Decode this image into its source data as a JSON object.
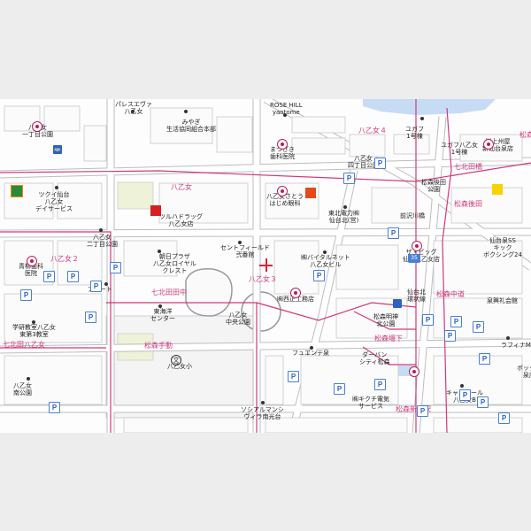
{
  "colors": {
    "road": "#ffffff",
    "road_edge": "#bdbdbd",
    "block": "#f3f3f3",
    "boundary": "#d0397c",
    "water": "#c6dcf4",
    "park": "#dfe9c9",
    "outside": "#ededed",
    "marker": "#e0203a"
  },
  "marker": {
    "icon": "crosshair-marker-icon"
  },
  "areas": [
    {
      "name": "八乙女"
    },
    {
      "name": "八乙女４"
    },
    {
      "name": "八乙女２"
    },
    {
      "name": "八乙女３"
    },
    {
      "name": "七北田田中"
    },
    {
      "name": "松森手動"
    },
    {
      "name": "七北田八乙女"
    },
    {
      "name": "松森後田"
    },
    {
      "name": "七北田橋"
    },
    {
      "name": "松森中道"
    },
    {
      "name": "松森堰下"
    },
    {
      "name": "松森新ケ沢"
    },
    {
      "name": "松森"
    }
  ],
  "labels": [
    {
      "text": "パレスエヴァ\n八乙女"
    },
    {
      "text": "みやぎ\n生活協同組合本部"
    },
    {
      "text": "ROSE HILL\nyaotome"
    },
    {
      "text": "八乙女\n一丁目公園"
    },
    {
      "text": "まつざき\n歯科医院"
    },
    {
      "text": "八乙女\n四丁目公園"
    },
    {
      "text": "ユガフ\n1号棟"
    },
    {
      "text": "ユガフ八乙女\n1号棟"
    },
    {
      "text": "㈱上州屋\n新仙台泉店"
    },
    {
      "text": "松森後田\n公園"
    },
    {
      "text": "ツクイ仙台\n八乙女\nデイサービス"
    },
    {
      "text": "ツルハドラッグ\n八乙女店"
    },
    {
      "text": "八乙女さとう\nはじめ眼科"
    },
    {
      "text": "東北電力㈱\n仙台北(営)"
    },
    {
      "text": "前沢川橋"
    },
    {
      "text": "八乙女\n二丁目公園"
    },
    {
      "text": "セントフィールド\n弐番館"
    },
    {
      "text": "ザ・ビッグ\n仙台八乙女店"
    },
    {
      "text": "仙台泉SS\nキック\nボクシング24"
    },
    {
      "text": "青柳歯科\n医院"
    },
    {
      "text": "朝日プラザ\n八乙女ロイヤル\nクレスト"
    },
    {
      "text": "㈱バイタルネット\n八乙女ビル"
    },
    {
      "text": "アパート"
    },
    {
      "text": "㈱西正工務店"
    },
    {
      "text": "仙台北\n環状線"
    },
    {
      "text": "泉興礼会館"
    },
    {
      "text": "東海洋\nセンター"
    },
    {
      "text": "八乙女\n中央公園"
    },
    {
      "text": "松森明神\n北公園"
    },
    {
      "text": "学研教室八乙女\n東第3教室"
    },
    {
      "text": "ラフィナM"
    },
    {
      "text": "八乙女小"
    },
    {
      "text": "フュエンテ泉"
    },
    {
      "text": "ダーバン\nシティ松森"
    },
    {
      "text": "八乙女\n南公園"
    },
    {
      "text": "キャステール\n八乙女B"
    },
    {
      "text": "㈱キクチ電気\nサービス"
    },
    {
      "text": "ソシアルマンシ\nヴィラ南光台"
    },
    {
      "text": "ボックス\n泉店"
    }
  ],
  "parking_icon": "P",
  "route_shield": {
    "text": "35"
  },
  "bus_icon": "bus-stop-icon"
}
